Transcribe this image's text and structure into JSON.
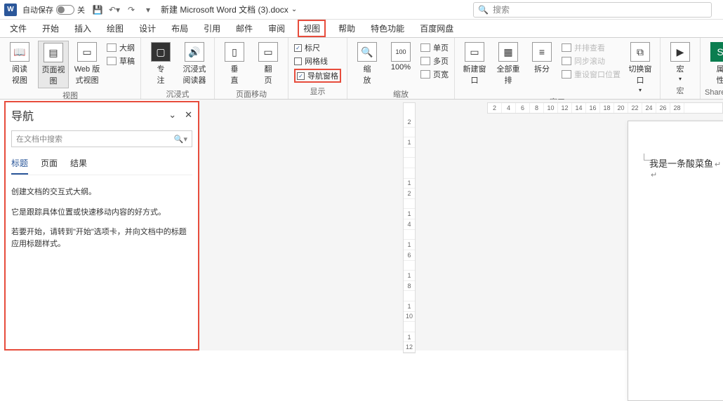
{
  "titlebar": {
    "autosave_label": "自动保存",
    "autosave_state": "关",
    "doc_title": "新建 Microsoft Word 文档 (3).docx",
    "search_placeholder": "搜索"
  },
  "tabs": {
    "file": "文件",
    "home": "开始",
    "insert": "插入",
    "draw": "绘图",
    "design": "设计",
    "layout": "布局",
    "references": "引用",
    "mailings": "邮件",
    "review": "审阅",
    "view": "视图",
    "help": "帮助",
    "featured": "特色功能",
    "baidu": "百度网盘"
  },
  "ribbon": {
    "views": {
      "reading": "阅读\n视图",
      "print_layout": "页面视图",
      "web_layout": "Web 版式视图",
      "outline": "大纲",
      "draft": "草稿",
      "group": "视图"
    },
    "immersive": {
      "focus": "专\n注",
      "reader": "沉浸式\n阅读器",
      "group": "沉浸式"
    },
    "page_move": {
      "vertical": "垂\n直",
      "side": "翻\n页",
      "group": "页面移动"
    },
    "show": {
      "ruler": "标尺",
      "gridlines": "网格线",
      "nav_pane": "导航窗格",
      "group": "显示"
    },
    "zoom": {
      "zoom": "缩\n放",
      "hundred": "100%",
      "one_page": "单页",
      "multi_page": "多页",
      "page_width": "页宽",
      "group": "缩放"
    },
    "window": {
      "new_window": "新建窗口",
      "arrange_all": "全部重排",
      "split": "拆分",
      "side_by_side": "并排查看",
      "sync_scroll": "同步滚动",
      "reset_pos": "重设窗口位置",
      "switch": "切换窗口",
      "group": "窗口"
    },
    "macros": {
      "macros": "宏",
      "group": "宏"
    },
    "properties": {
      "properties": "属\n性",
      "group": "SharePoint"
    }
  },
  "nav": {
    "title": "导航",
    "search_placeholder": "在文档中搜索",
    "tab_headings": "标题",
    "tab_pages": "页面",
    "tab_results": "结果",
    "p1": "创建文档的交互式大纲。",
    "p2": "它是跟踪具体位置或快速移动内容的好方式。",
    "p3": "若要开始，请转到\"开始\"选项卡，并向文档中的标题应用标题样式。"
  },
  "ruler_h": [
    "2",
    "4",
    "6",
    "8",
    "10",
    "12",
    "14",
    "16",
    "18",
    "20",
    "22",
    "24",
    "26",
    "28"
  ],
  "ruler_v": [
    "2",
    "",
    "1",
    "",
    "",
    "",
    "1",
    "2",
    "",
    "1",
    "4",
    "",
    "1",
    "6",
    "",
    "1",
    "8",
    "",
    "1",
    "10",
    "",
    "1",
    "12"
  ],
  "document": {
    "line1": "我是一条酸菜鱼"
  }
}
